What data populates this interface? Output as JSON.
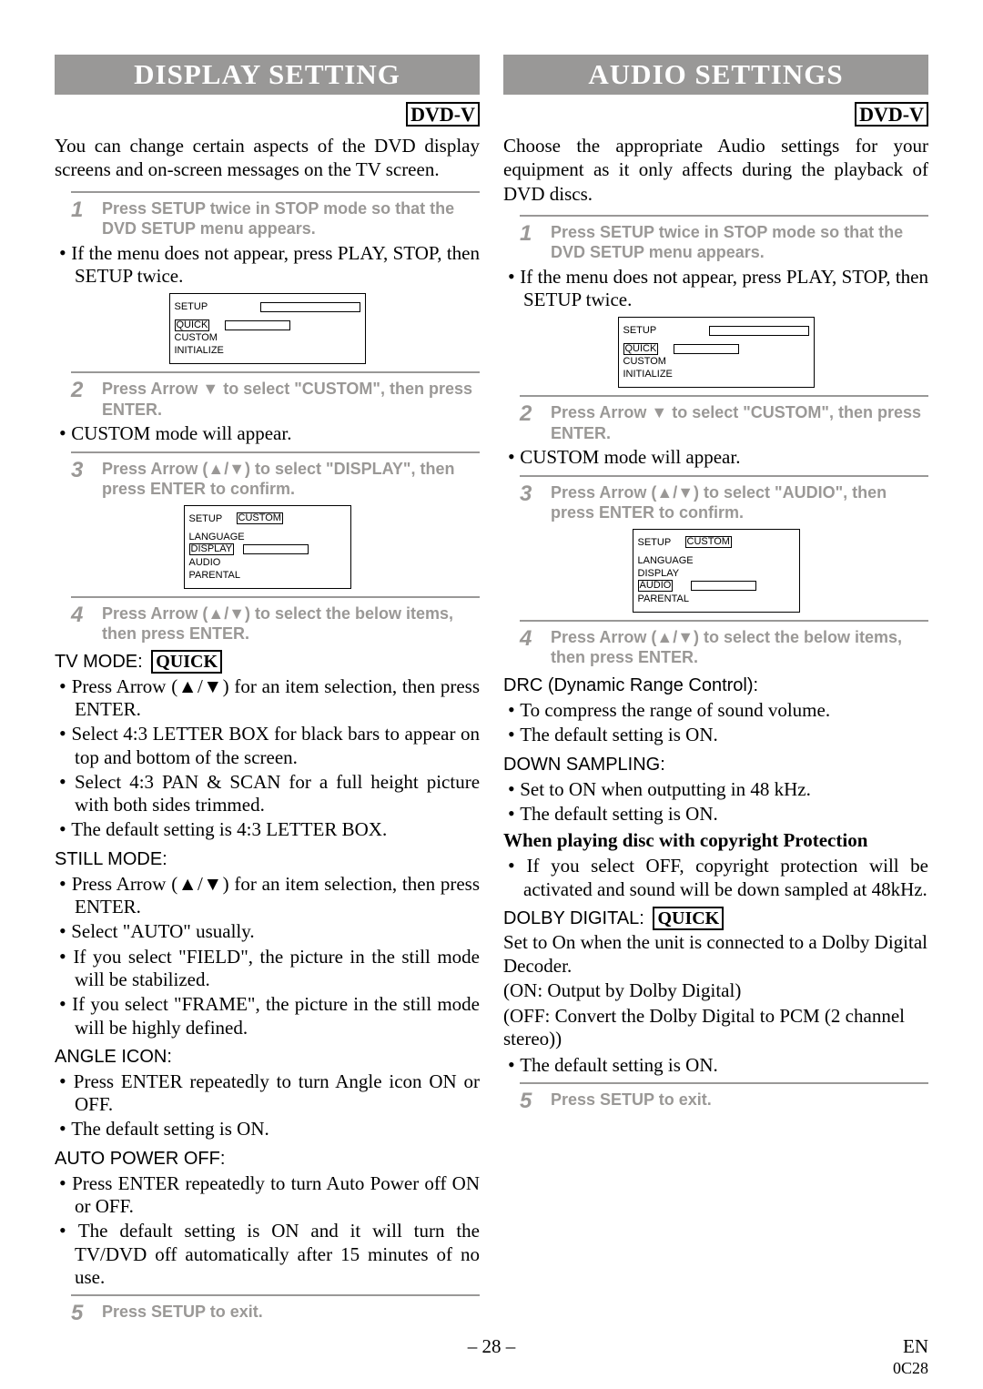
{
  "left": {
    "banner": "DISPLAY SETTING",
    "tag": "DVD-V",
    "intro": "You can change certain aspects of the DVD display screens and on-screen messages on the TV screen.",
    "step1_text": "Press SETUP twice in STOP mode so that the DVD SETUP menu appears.",
    "note1": "If the menu does not appear, press PLAY, STOP, then SETUP twice.",
    "dia1_header": "SETUP",
    "dia1_items": [
      "QUICK",
      "CUSTOM",
      "INITIALIZE"
    ],
    "step2_text": "Press Arrow ▼ to select \"CUSTOM\", then press ENTER.",
    "note2": "CUSTOM mode will appear.",
    "step3_text": "Press Arrow (▲/▼) to select \"DISPLAY\", then press ENTER to confirm.",
    "dia2_header": "SETUP",
    "dia2_selected": "CUSTOM",
    "dia2_items": [
      "LANGUAGE",
      "DISPLAY",
      "AUDIO",
      "PARENTAL"
    ],
    "step4_text": "Press Arrow (▲/▼) to select the below items, then press ENTER.",
    "tvmode_label": "TV MODE:",
    "quick_label": "QUICK",
    "tvmode_bullets": [
      "Press Arrow (▲/▼) for an item selection, then press ENTER.",
      "Select 4:3 LETTER BOX for black bars to appear on top and bottom of the screen.",
      "Select 4:3 PAN & SCAN for a full height picture with both sides trimmed.",
      "The default setting is 4:3 LETTER BOX."
    ],
    "still_label": "STILL MODE:",
    "still_bullets": [
      "Press Arrow (▲/▼) for an item selection, then press ENTER.",
      "Select \"AUTO\" usually.",
      "If you select \"FIELD\", the picture in the still mode will be stabilized.",
      "If you select \"FRAME\", the picture in the still mode will be highly defined."
    ],
    "angle_label": "ANGLE ICON:",
    "angle_bullets": [
      "Press ENTER repeatedly to turn Angle icon ON or OFF.",
      "The default setting is ON."
    ],
    "apo_label": "AUTO POWER OFF:",
    "apo_bullets": [
      "Press ENTER repeatedly to turn Auto Power off ON or OFF.",
      "The default setting is ON and it will turn the TV/DVD off automatically after 15 minutes of no use."
    ],
    "step5_text": "Press SETUP to exit."
  },
  "right": {
    "banner": "AUDIO SETTINGS",
    "tag": "DVD-V",
    "intro": "Choose the appropriate Audio settings for your equipment as it only affects during the playback of DVD discs.",
    "step1_text": "Press SETUP twice in STOP mode so that the DVD SETUP menu appears.",
    "note1": "If the menu does not appear, press PLAY, STOP, then SETUP twice.",
    "dia1_header": "SETUP",
    "dia1_items": [
      "QUICK",
      "CUSTOM",
      "INITIALIZE"
    ],
    "step2_text": "Press Arrow ▼ to select \"CUSTOM\", then press ENTER.",
    "note2": "CUSTOM mode will appear.",
    "step3_text": "Press Arrow (▲/▼) to select \"AUDIO\", then press ENTER to confirm.",
    "dia2_header": "SETUP",
    "dia2_selected": "CUSTOM",
    "dia2_items": [
      "LANGUAGE",
      "DISPLAY",
      "AUDIO",
      "PARENTAL"
    ],
    "step4_text": "Press Arrow (▲/▼) to select the below items, then press ENTER.",
    "drc_label": "DRC (Dynamic Range Control):",
    "drc_bullets": [
      "To compress the range of sound volume.",
      "The default setting is ON."
    ],
    "down_label": "DOWN SAMPLING:",
    "down_bullets": [
      "Set to ON when outputting in 48 kHz.",
      "The default setting is ON."
    ],
    "down_bold": "When playing disc with copyright Protection",
    "down_note": "If you select OFF, copyright protection will be activated and sound will be down sampled at 48kHz.",
    "dolby_label": "DOLBY DIGITAL:",
    "quick_label": "QUICK",
    "dolby_lines": [
      "Set to On when the unit is connected to a Dolby Digital Decoder.",
      "(ON: Output by Dolby Digital)",
      "(OFF: Convert the Dolby Digital to PCM (2 channel stereo))"
    ],
    "dolby_bullet": "The default setting is ON.",
    "step5_text": "Press SETUP to exit."
  },
  "page": {
    "num": "– 28 –",
    "lang": "EN",
    "code": "0C28"
  },
  "steps": {
    "s1": "1",
    "s2": "2",
    "s3": "3",
    "s4": "4",
    "s5": "5"
  }
}
